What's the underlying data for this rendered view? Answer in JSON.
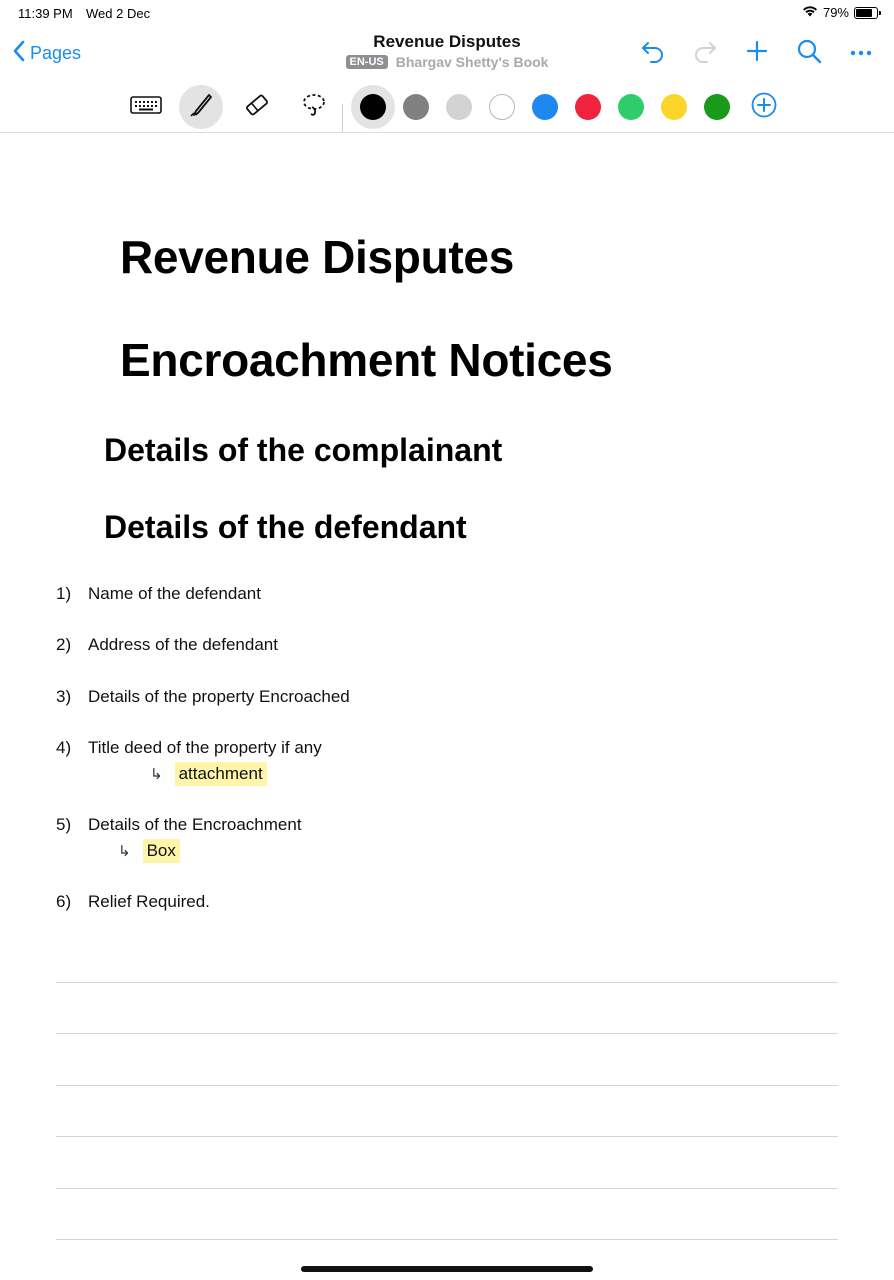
{
  "status_bar": {
    "time": "11:39 PM",
    "date": "Wed 2 Dec",
    "battery_percent": "79%",
    "battery_level": 0.79
  },
  "nav": {
    "back_label": "Pages",
    "title": "Revenue Disputes",
    "lang_badge": "EN-US",
    "notebook": "Bhargav Shetty's Book",
    "actions": [
      "undo-icon",
      "redo-icon",
      "plus-icon",
      "search-icon",
      "more-icon"
    ]
  },
  "toolbar": {
    "tools": [
      "keyboard-icon",
      "pen-icon",
      "eraser-icon",
      "lasso-icon"
    ],
    "active_tool": "pen-icon",
    "colors": [
      "#000000",
      "#808080",
      "#d3d3d3",
      "#ffffff",
      "#1e88f0",
      "#f0223c",
      "#2ecc6a",
      "#fbd52a",
      "#1a9a1a"
    ],
    "selected_color": "#000000",
    "accent": "#1a8cf0"
  },
  "document": {
    "heading1": "Revenue Disputes",
    "heading2": "Encroachment Notices",
    "section1": "Details of the complainant",
    "section2": "Details of the defendant",
    "items": [
      {
        "num": "1)",
        "text": "Name of the defendant"
      },
      {
        "num": "2)",
        "text": "Address of the defendant"
      },
      {
        "num": "3)",
        "text": "Details of the property Encroached"
      },
      {
        "num": "4)",
        "text": "Title deed of the property if any",
        "sub": "attachment"
      },
      {
        "num": "5)",
        "text": "Details of the Encroachment",
        "sub": "Box"
      },
      {
        "num": "6)",
        "text": "Relief Required."
      }
    ],
    "highlight_color": "#fff5a8"
  }
}
